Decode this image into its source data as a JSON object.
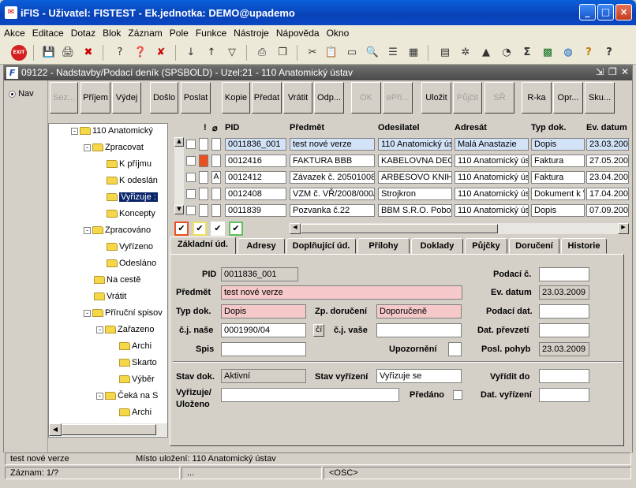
{
  "window": {
    "title": "iFIS - Uživatel: FISTEST - Ek.jednotka: DEMO@upademo",
    "app_icon": "ifis-icon",
    "minimize_label": "_",
    "maximize_label": "□",
    "close_label": "×"
  },
  "menu": [
    "Akce",
    "Editace",
    "Dotaz",
    "Blok",
    "Záznam",
    "Pole",
    "Funkce",
    "Nástroje",
    "Nápověda",
    "Okno"
  ],
  "toolbar": {
    "exit_label": "EXIT",
    "icons": [
      "exit-icon",
      "save-icon",
      "print-form-icon",
      "delete-record-icon",
      "help-query-icon",
      "enter-query-icon",
      "cancel-query-icon",
      "sort-asc-icon",
      "sort-desc-icon",
      "filter-icon",
      "print-icon",
      "copy-icon",
      "cut-icon",
      "paste-icon",
      "zoom-icon",
      "list-icon",
      "grid-icon",
      "calculator-icon",
      "settings-icon",
      "triangle-icon",
      "clock-icon",
      "sum-icon",
      "excel-icon",
      "web-icon",
      "help-icon",
      "question-icon"
    ]
  },
  "form": {
    "title": "09122 - Nadstavby/Podací deník (SPSBOLD) - Uzel:21 - 110 Anatomický ústav",
    "nav_label": "Nav",
    "buttons": [
      {
        "label": "Sez...",
        "disabled": true
      },
      {
        "label": "Příjem",
        "disabled": false
      },
      {
        "label": "Výdej",
        "disabled": false
      },
      {
        "label": "Došlo",
        "disabled": false
      },
      {
        "label": "Poslat",
        "disabled": false
      },
      {
        "label": "Kopie",
        "disabled": false
      },
      {
        "label": "Předat",
        "disabled": false
      },
      {
        "label": "Vrátit",
        "disabled": false
      },
      {
        "label": "Odp...",
        "disabled": false
      },
      {
        "label": "OK",
        "disabled": true
      },
      {
        "label": "ePři...",
        "disabled": true
      },
      {
        "label": "Uložit",
        "disabled": false
      },
      {
        "label": "Půjčit",
        "disabled": true
      },
      {
        "label": "SŘ",
        "disabled": true
      },
      {
        "label": "R-ka",
        "disabled": false
      },
      {
        "label": "Opr...",
        "disabled": false
      },
      {
        "label": "Sku...",
        "disabled": false
      }
    ]
  },
  "tree": {
    "nodes": [
      {
        "label": "110 Anatomický",
        "level": 0,
        "expand": "-"
      },
      {
        "label": "Zpracovat",
        "level": 1,
        "expand": "-"
      },
      {
        "label": "K příjmu",
        "level": 2,
        "expand": ""
      },
      {
        "label": "K odeslán",
        "level": 2,
        "expand": ""
      },
      {
        "label": "Vyřizuje :",
        "level": 2,
        "expand": "",
        "selected": true
      },
      {
        "label": "Koncepty",
        "level": 2,
        "expand": ""
      },
      {
        "label": "Zpracováno",
        "level": 1,
        "expand": "-"
      },
      {
        "label": "Vyřízeno",
        "level": 2,
        "expand": ""
      },
      {
        "label": "Odesláno",
        "level": 2,
        "expand": ""
      },
      {
        "label": "Na cestě",
        "level": 1,
        "expand": ""
      },
      {
        "label": "Vrátit",
        "level": 1,
        "expand": ""
      },
      {
        "label": "Příruční spisov",
        "level": 1,
        "expand": "-"
      },
      {
        "label": "Zařazeno",
        "level": 2,
        "expand": "-"
      },
      {
        "label": "Archi",
        "level": 3,
        "expand": ""
      },
      {
        "label": "Skarto",
        "level": 3,
        "expand": ""
      },
      {
        "label": "Výběr",
        "level": 3,
        "expand": ""
      },
      {
        "label": "Čeká na S",
        "level": 2,
        "expand": "-"
      },
      {
        "label": "Archi",
        "level": 3,
        "expand": ""
      }
    ]
  },
  "grid": {
    "columns": {
      "excl": "!",
      "attach": "📎",
      "pid": "PID",
      "predmet": "Předmět",
      "odesilatel": "Odesilatel",
      "adresat": "Adresát",
      "typ": "Typ dok.",
      "datum": "Ev. datum"
    },
    "rows": [
      {
        "pid": "0011836_001",
        "predmet": "test nové verze",
        "odesilatel": "110 Anatomický ús",
        "adresat": "Malá Anastazie",
        "typ": "Dopis",
        "datum": "23.03.200",
        "flag": "",
        "flag_color": "",
        "selected": true
      },
      {
        "pid": "0012416",
        "predmet": "FAKTURA BBB",
        "odesilatel": "KABELOVNA DECI",
        "adresat": "110 Anatomický ús",
        "typ": "Faktura",
        "datum": "27.05.200",
        "flag": "",
        "flag_color": "#e8501e",
        "selected": false
      },
      {
        "pid": "0012412",
        "predmet": "Závazek č. 20501008",
        "odesilatel": "ARBESOVO KNIHK",
        "adresat": "110 Anatomický ús",
        "typ": "Faktura",
        "datum": "23.04.200",
        "flag": "A",
        "flag_color": "",
        "selected": false
      },
      {
        "pid": "0012408",
        "predmet": "VZM č. VŘ/2008/000/",
        "odesilatel": "Strojkron",
        "adresat": "110 Anatomický ús",
        "typ": "Dokument k V",
        "datum": "17.04.200",
        "flag": "",
        "flag_color": "",
        "selected": false
      },
      {
        "pid": "0011839",
        "predmet": "Pozvanka č.22",
        "odesilatel": "BBM S.R.O. Poboč",
        "adresat": "110 Anatomický ús",
        "typ": "Dopis",
        "datum": "07.09.200",
        "flag": "",
        "flag_color": "",
        "selected": false
      }
    ],
    "legend_colors": [
      "#e8501e",
      "#f0e060",
      "#ffffff",
      "#60c060"
    ]
  },
  "tabs": [
    "Základní úd.",
    "Adresy",
    "Doplňující úd.",
    "Přílohy",
    "Doklady",
    "Půjčky",
    "Doručení",
    "Historie"
  ],
  "detail": {
    "pid_label": "PID",
    "pid": "0011836_001",
    "podaci_label": "Podací č.",
    "podaci": "",
    "predmet_label": "Předmět",
    "predmet": "test nové verze",
    "evdatum_label": "Ev. datum",
    "evdatum": "23.03.2009",
    "typ_label": "Typ dok.",
    "typ": "Dopis",
    "zpdoruceni_label": "Zp. doručení",
    "zpdoruceni": "Doporučeně",
    "podacidat_label": "Podací dat.",
    "podacidat": "",
    "cjnase_label": "č.j. naše",
    "cjnase": "0001990/04",
    "cj_btn": "čí",
    "cjvase_label": "č.j. vaše",
    "cjvase": "",
    "datprevzeti_label": "Dat. převzetí",
    "datprevzeti": "",
    "spis_label": "Spis",
    "spis": "",
    "upozorneni_label": "Upozornění",
    "poslpohyb_label": "Posl. pohyb",
    "poslpohyb": "23.03.2009",
    "stavdok_label": "Stav dok.",
    "stavdok": "Aktivní",
    "stavvyrizeni_label": "Stav vyřízení",
    "stavvyrizeni": "Vyřizuje se",
    "vyriditdo_label": "Vyřídit do",
    "vyriditdo": "",
    "vyrizuje_label1": "Vyřizuje/",
    "vyrizuje_label2": "Uloženo",
    "vyrizuje": "",
    "predano_label": "Předáno",
    "datvyrizeni_label": "Dat. vyřízení",
    "datvyrizeni": ""
  },
  "status": {
    "left": "test nové verze",
    "right": "Místo uložení: 110 Anatomický ústav",
    "zaznam": "Záznam: 1/?",
    "dots": "...",
    "osc": "<OSC>"
  }
}
